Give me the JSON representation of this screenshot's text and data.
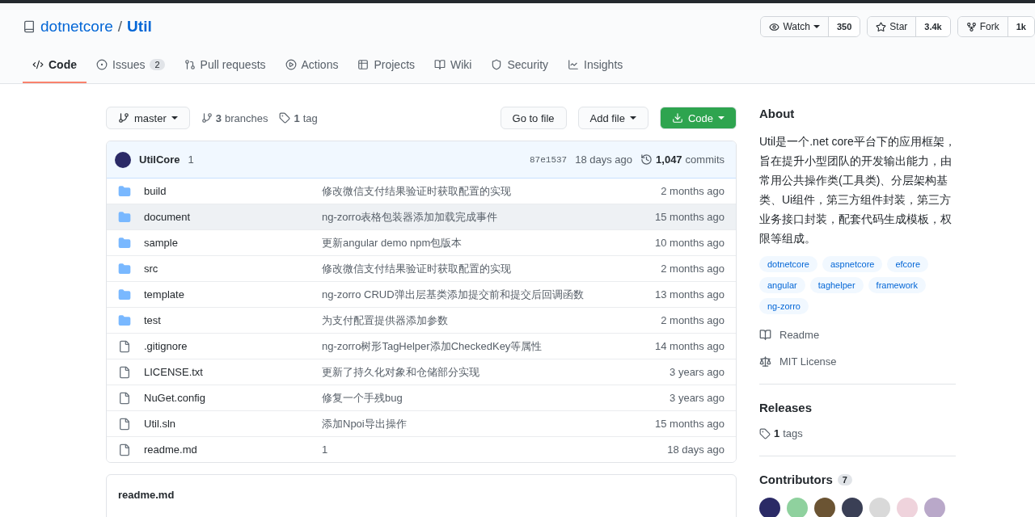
{
  "repo": {
    "owner": "dotnetcore",
    "separator": "/",
    "name": "Util"
  },
  "header_buttons": [
    {
      "label": "Watch",
      "count": "350",
      "dropdown": true
    },
    {
      "label": "Star",
      "count": "3.4k",
      "dropdown": false
    },
    {
      "label": "Fork",
      "count": "1k",
      "dropdown": false
    }
  ],
  "tabs": [
    {
      "label": "Code",
      "selected": true
    },
    {
      "label": "Issues",
      "count": "2",
      "selected": false
    },
    {
      "label": "Pull requests",
      "selected": false
    },
    {
      "label": "Actions",
      "selected": false
    },
    {
      "label": "Projects",
      "selected": false
    },
    {
      "label": "Wiki",
      "selected": false
    },
    {
      "label": "Security",
      "selected": false
    },
    {
      "label": "Insights",
      "selected": false
    }
  ],
  "toolbar": {
    "branch": "master",
    "branches_count": "3",
    "branches_label": "branches",
    "tags_count": "1",
    "tags_label": "tag",
    "go_to_file": "Go to file",
    "add_file": "Add file",
    "code": "Code"
  },
  "commit": {
    "author": "UtilCore",
    "message": "1",
    "sha": "87e1537",
    "time": "18 days ago",
    "commits_count": "1,047",
    "commits_label": "commits"
  },
  "files": [
    {
      "kind": "folder",
      "name": "build",
      "message": "修改微信支付结果验证时获取配置的实现",
      "time": "2 months ago",
      "hovered": false
    },
    {
      "kind": "folder",
      "name": "document",
      "message": "ng-zorro表格包装器添加加载完成事件",
      "time": "15 months ago",
      "hovered": true
    },
    {
      "kind": "folder",
      "name": "sample",
      "message": "更新angular demo npm包版本",
      "time": "10 months ago",
      "hovered": false
    },
    {
      "kind": "folder",
      "name": "src",
      "message": "修改微信支付结果验证时获取配置的实现",
      "time": "2 months ago",
      "hovered": false
    },
    {
      "kind": "folder",
      "name": "template",
      "message": "ng-zorro CRUD弹出层基类添加提交前和提交后回调函数",
      "time": "13 months ago",
      "hovered": false
    },
    {
      "kind": "folder",
      "name": "test",
      "message": "为支付配置提供器添加参数",
      "time": "2 months ago",
      "hovered": false
    },
    {
      "kind": "file",
      "name": ".gitignore",
      "message": "ng-zorro树形TagHelper添加CheckedKey等属性",
      "time": "14 months ago",
      "hovered": false
    },
    {
      "kind": "file",
      "name": "LICENSE.txt",
      "message": "更新了持久化对象和仓储部分实现",
      "time": "3 years ago",
      "hovered": false
    },
    {
      "kind": "file",
      "name": "NuGet.config",
      "message": "修复一个手残bug",
      "time": "3 years ago",
      "hovered": false
    },
    {
      "kind": "file",
      "name": "Util.sln",
      "message": "添加Npoi导出操作",
      "time": "15 months ago",
      "hovered": false
    },
    {
      "kind": "file",
      "name": "readme.md",
      "message": "1",
      "time": "18 days ago",
      "hovered": false
    }
  ],
  "readme": {
    "title": "readme.md"
  },
  "about": {
    "title": "About",
    "description": "Util是一个.net core平台下的应用框架，旨在提升小型团队的开发输出能力，由常用公共操作类(工具类)、分层架构基类、Ui组件，第三方组件封装，第三方业务接口封装，配套代码生成模板，权限等组成。",
    "topics": [
      "dotnetcore",
      "aspnetcore",
      "efcore",
      "angular",
      "taghelper",
      "framework",
      "ng-zorro"
    ],
    "links": [
      {
        "kind": "readme",
        "label": "Readme"
      },
      {
        "kind": "license",
        "label": "MIT License"
      }
    ]
  },
  "releases": {
    "title": "Releases",
    "count": "1",
    "label": "tags"
  },
  "contributors": {
    "title": "Contributors",
    "count": "7",
    "avatars": [
      {
        "color": "#2b2a66"
      },
      {
        "color": "#8fd19e"
      },
      {
        "color": "#6b5433"
      },
      {
        "color": "#3a3f55"
      },
      {
        "color": "#d9d9d9"
      },
      {
        "color": "#efd3dc"
      },
      {
        "color": "#b9a8c9"
      }
    ]
  }
}
